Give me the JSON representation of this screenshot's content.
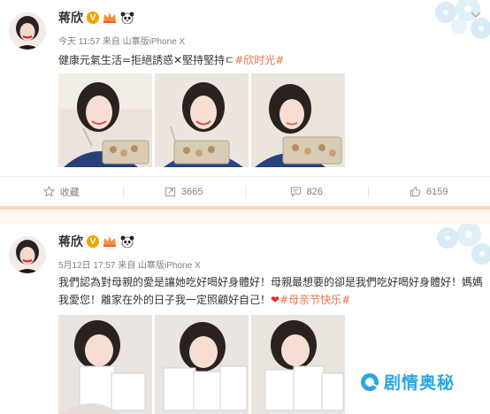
{
  "posts": [
    {
      "username": "蒋欣",
      "verified_badge": "V",
      "meta": "今天 11:57 来自 山寨版iPhone X",
      "text": "健康元氣生活=拒絕誘惑✕堅持堅持ㄷ",
      "hashtag": "#欣时光#",
      "actions": {
        "favorite_label": "收藏",
        "repost_count": "3665",
        "comment_count": "826",
        "like_count": "6159"
      }
    },
    {
      "username": "蒋欣",
      "verified_badge": "V",
      "meta": "5月12日 17:57 来自 山寨版iPhone X",
      "text": "我們認為對母親的愛是讓她吃好喝好身體好！母親最想要的卻是我們吃好喝好身體好！媽媽我愛您！離家在外的日子我一定照顧好自己！",
      "heart": "❤",
      "hashtag": "#母亲节快乐#"
    }
  ],
  "watermark": "剧情奥秘",
  "icons": {
    "favorite": "star-icon",
    "repost": "repost-icon",
    "comment": "comment-icon",
    "like": "thumbs-up-icon"
  },
  "colors": {
    "hashtag": "#eb7350",
    "watermark": "#2ba6e1",
    "divider": "#ffd7b3"
  }
}
